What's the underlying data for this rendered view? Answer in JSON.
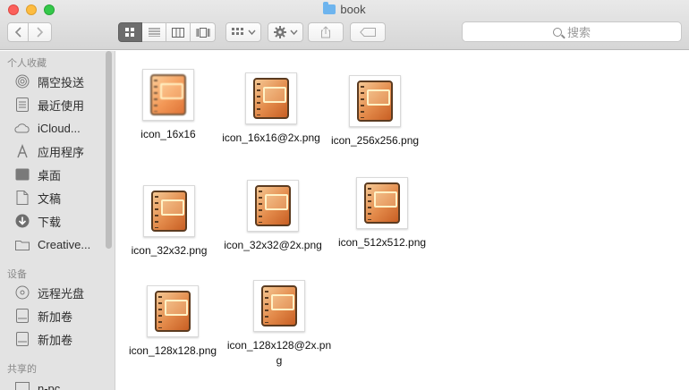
{
  "window": {
    "title": "book"
  },
  "toolbar": {
    "back_icon": "chevron-left-icon",
    "forward_icon": "chevron-right-icon",
    "view_modes": [
      "icon-view-icon",
      "list-view-icon",
      "column-view-icon",
      "gallery-view-icon"
    ],
    "search_placeholder": "搜索"
  },
  "sidebar": {
    "sections": [
      {
        "title": "个人收藏",
        "items": [
          "隔空投送",
          "最近使用",
          "iCloud...",
          "应用程序",
          "桌面",
          "文稿",
          "下载",
          "Creative..."
        ]
      },
      {
        "title": "设备",
        "items": [
          "远程光盘",
          "新加卷",
          "新加卷"
        ]
      },
      {
        "title": "共享的",
        "items": [
          "n-pc"
        ]
      }
    ]
  },
  "files": [
    {
      "name": "icon_16x16"
    },
    {
      "name": "icon_16x16@2x.png"
    },
    {
      "name": "icon_256x256.png"
    },
    {
      "name": "icon_32x32.png"
    },
    {
      "name": "icon_32x32@2x.png"
    },
    {
      "name": "icon_512x512.png"
    },
    {
      "name": "icon_128x128.png"
    },
    {
      "name": "icon_128x128@2x.png"
    }
  ],
  "colors": {
    "close": "#fc605b",
    "minimize": "#fdbc40",
    "maximize": "#34c84a",
    "folder": "#6db4ee"
  }
}
